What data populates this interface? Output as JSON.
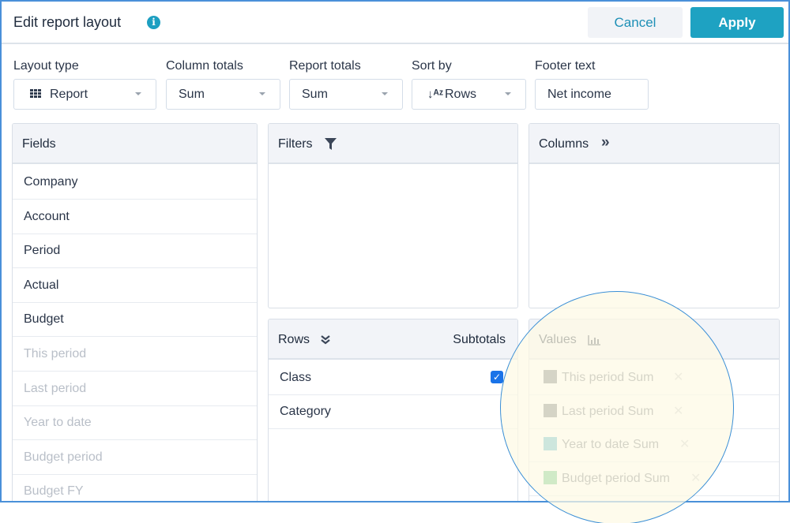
{
  "header": {
    "title": "Edit report layout",
    "info_icon": "info-icon",
    "cancel_label": "Cancel",
    "apply_label": "Apply"
  },
  "options": {
    "layout_type": {
      "label": "Layout type",
      "value": "Report",
      "icon": "grid-icon"
    },
    "column_totals": {
      "label": "Column totals",
      "value": "Sum"
    },
    "report_totals": {
      "label": "Report totals",
      "value": "Sum"
    },
    "sort_by": {
      "label": "Sort by",
      "value": "Rows",
      "icon": "sort-alpha-down-icon",
      "icon_glyph": "↓ᴬᶻ"
    },
    "footer_text": {
      "label": "Footer text",
      "value": "Net income"
    }
  },
  "fields": {
    "title": "Fields",
    "items": [
      {
        "label": "Company",
        "enabled": true
      },
      {
        "label": "Account",
        "enabled": true
      },
      {
        "label": "Period",
        "enabled": true
      },
      {
        "label": "Actual",
        "enabled": true
      },
      {
        "label": "Budget",
        "enabled": true
      },
      {
        "label": "This period",
        "enabled": false
      },
      {
        "label": "Last period",
        "enabled": false
      },
      {
        "label": "Year to date",
        "enabled": false
      },
      {
        "label": "Budget period",
        "enabled": false
      },
      {
        "label": "Budget FY",
        "enabled": false
      }
    ]
  },
  "filters": {
    "title": "Filters",
    "icon": "filter-icon"
  },
  "columns": {
    "title": "Columns",
    "icon": "chevrons-right-icon",
    "icon_glyph": "»"
  },
  "rows": {
    "title": "Rows",
    "icon": "chevrons-down-icon",
    "icon_glyph": "≚",
    "subtotals_label": "Subtotals",
    "items": [
      {
        "label": "Class",
        "subtotal": true
      },
      {
        "label": "Category",
        "subtotal": false
      }
    ]
  },
  "values": {
    "title": "Values",
    "icon": "bar-chart-icon",
    "remove_glyph": "✕",
    "items": [
      {
        "label": "This period Sum",
        "color": "#6d7278"
      },
      {
        "label": "Last period Sum",
        "color": "#6d7278"
      },
      {
        "label": "Year to date Sum",
        "color": "#4fb3c8"
      },
      {
        "label": "Budget period Sum",
        "color": "#5cc279"
      },
      {
        "label": "",
        "color": "#4bb86a"
      }
    ]
  },
  "checkbox_glyph": "✓"
}
